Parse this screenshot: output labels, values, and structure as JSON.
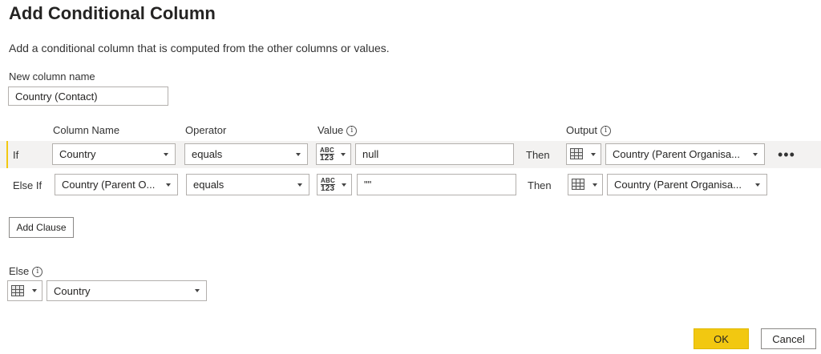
{
  "dialog": {
    "title": "Add Conditional Column",
    "description": "Add a conditional column that is computed from the other columns or values."
  },
  "new_column": {
    "label": "New column name",
    "value": "Country (Contact)"
  },
  "headers": {
    "column_name": "Column Name",
    "operator": "Operator",
    "value": "Value",
    "output": "Output",
    "info_glyph": "i"
  },
  "clauses": [
    {
      "keyword": "If",
      "column": "Country",
      "operator": "equals",
      "value_type_top": "ABC",
      "value_type_bottom": "123",
      "value": "null",
      "then": "Then",
      "output": "Country (Parent Organisa...",
      "more": "•••"
    },
    {
      "keyword": "Else If",
      "column": "Country (Parent O...",
      "operator": "equals",
      "value_type_top": "ABC",
      "value_type_bottom": "123",
      "value": "\"\"",
      "then": "Then",
      "output": "Country (Parent Organisa..."
    }
  ],
  "add_clause": "Add Clause",
  "else": {
    "label": "Else",
    "value": "Country"
  },
  "buttons": {
    "ok": "OK",
    "cancel": "Cancel"
  },
  "colors": {
    "accent": "#f2c811",
    "row_highlight": "#f3f2f1"
  },
  "icons": {
    "type_picker": "abc-123-icon",
    "output_picker": "table-icon",
    "info": "info-icon",
    "dropdown": "chevron-down-icon",
    "more": "more-options-icon"
  }
}
